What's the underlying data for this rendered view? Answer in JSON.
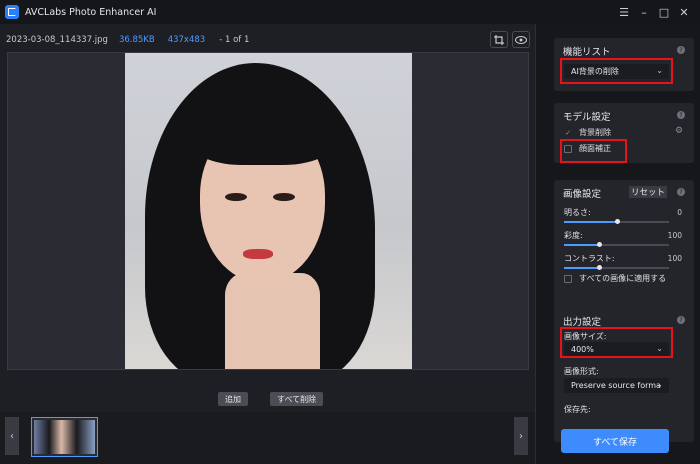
{
  "app": {
    "title": "AVCLabs Photo Enhancer AI"
  },
  "window_controls": {
    "menu": "☰",
    "minimize": "–",
    "maximize": "□",
    "close": "✕"
  },
  "file": {
    "name": "2023-03-08_114337.jpg",
    "size": "36.85KB",
    "dimensions": "437x483",
    "page": "- 1 of 1"
  },
  "actions": {
    "add": "追加",
    "delete_all": "すべて削除"
  },
  "feature_list": {
    "title": "機能リスト",
    "selected": "AI背景の削除"
  },
  "model_settings": {
    "title": "モデル設定",
    "options": [
      {
        "label": "背景削除",
        "checked": true
      },
      {
        "label": "顔面補正",
        "checked": false
      }
    ]
  },
  "image_settings": {
    "title": "画像設定",
    "reset_label": "リセット",
    "sliders": [
      {
        "label": "明るさ:",
        "value": "0",
        "fraction": 0.5
      },
      {
        "label": "彩度:",
        "value": "100",
        "fraction": 0.33
      },
      {
        "label": "コントラスト:",
        "value": "100",
        "fraction": 0.33
      }
    ],
    "apply_all": "すべての画像に適用する"
  },
  "output_settings": {
    "title": "出力設定",
    "size_label": "画像サイズ:",
    "size_value": "400%",
    "format_label": "画像形式:",
    "format_value": "Preserve source forma",
    "save_to_label": "保存先:"
  },
  "save_all": "すべて保存"
}
